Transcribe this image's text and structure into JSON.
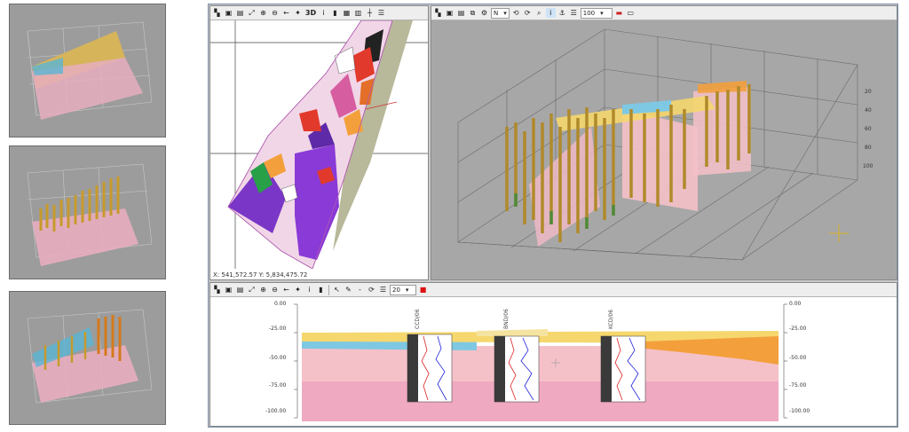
{
  "map_view": {
    "coordinates": "X: 541,572.57 Y: 5,834,475.72",
    "toolbar_icons": [
      "map-tool-icon",
      "save-icon",
      "print-icon",
      "fit-icon",
      "zoom-in-icon",
      "zoom-out-icon",
      "back-icon",
      "wand-icon",
      "3d-button",
      "info-icon",
      "column-icon",
      "layer-icon",
      "draw-icon",
      "crosshair-icon",
      "legend-icon"
    ],
    "label_3d": "3D"
  },
  "view3d": {
    "orientation": "N",
    "zoom": "100",
    "axis_values": [
      "20",
      "40",
      "60",
      "80",
      "100"
    ]
  },
  "section_view": {
    "zoom": "20",
    "left_scale": [
      "0.00",
      "-25.00",
      "-50.00",
      "-75.00",
      "-100.00"
    ],
    "right_scale": [
      "0.00",
      "-25.00",
      "-50.00",
      "-75.00",
      "-100.00"
    ],
    "wells": [
      "CCD/06",
      "BND/06",
      "KCD/06"
    ]
  },
  "colors": {
    "app_border": "#7a8fa8",
    "layer_yellow": "#f5d76e",
    "layer_blue": "#7ec8e3",
    "layer_pink": "#f5c1c8",
    "layer_deep_pink": "#efa9c0",
    "layer_orange": "#f3a03c",
    "log_red": "#d22",
    "log_blue": "#22d"
  }
}
